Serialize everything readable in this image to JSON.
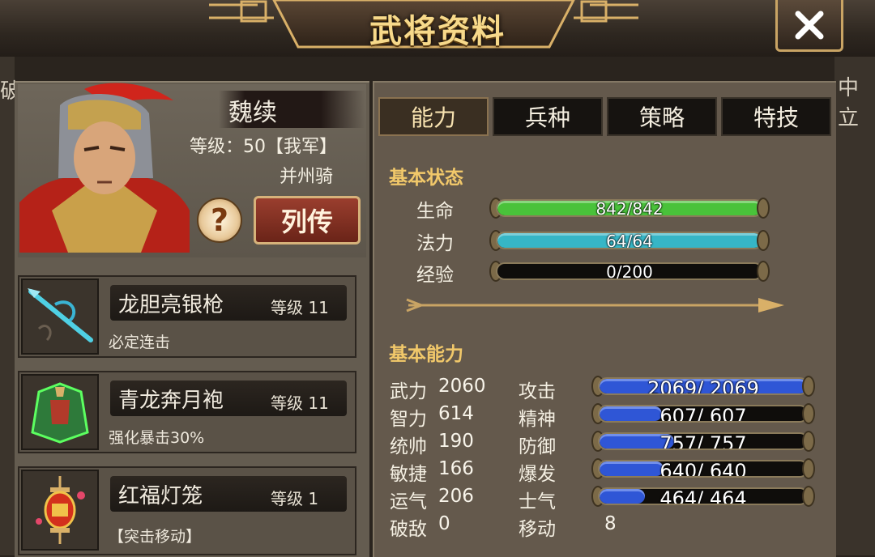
{
  "window": {
    "title": "武将资料",
    "close_label": "✕",
    "left_edge_text": "破",
    "right_edge_text": "中立"
  },
  "hero": {
    "name": "魏续",
    "level_text": "等级：50【我军】",
    "unit_type": "并州骑",
    "help_label": "?",
    "bio_button": "列传"
  },
  "equipment": [
    {
      "name": "龙胆亮银枪",
      "level": "等级 11",
      "effect": "必定连击",
      "icon": "spear-icon"
    },
    {
      "name": "青龙奔月袍",
      "level": "等级 11",
      "effect": "强化暴击30%",
      "icon": "robe-icon"
    },
    {
      "name": "红福灯笼",
      "level": "等级 1",
      "effect": "【突击移动】",
      "icon": "lantern-icon"
    }
  ],
  "tabs": [
    "能力",
    "兵种",
    "策略",
    "特技"
  ],
  "active_tab": "能力",
  "basic_status": {
    "title": "基本状态",
    "rows": [
      {
        "label": "生命",
        "text": "842/842",
        "fill": 1.0,
        "color": "#49c23a"
      },
      {
        "label": "法力",
        "text": "64/64",
        "fill": 1.0,
        "color": "#36b6c6"
      },
      {
        "label": "经验",
        "text": "0/200",
        "fill": 0.0,
        "color": "#36b6c6"
      }
    ]
  },
  "basic_ability": {
    "title": "基本能力",
    "left": [
      {
        "label": "武力",
        "value": "2060"
      },
      {
        "label": "智力",
        "value": "614"
      },
      {
        "label": "统帅",
        "value": "190"
      },
      {
        "label": "敏捷",
        "value": "166"
      },
      {
        "label": "运气",
        "value": "206"
      },
      {
        "label": "破敌",
        "value": "0"
      }
    ],
    "right": [
      {
        "label": "攻击",
        "text": "2069/ 2069",
        "fill": 1.0
      },
      {
        "label": "精神",
        "text": "607/ 607",
        "fill": 0.3
      },
      {
        "label": "防御",
        "text": "757/ 757",
        "fill": 0.36
      },
      {
        "label": "爆发",
        "text": "640/ 640",
        "fill": 0.31
      },
      {
        "label": "士气",
        "text": "464/ 464",
        "fill": 0.22
      }
    ],
    "move_label": "移动",
    "move_value": "8"
  },
  "colors": {
    "accent": "#f1c86a",
    "bar_blue": "#2f56d6"
  }
}
